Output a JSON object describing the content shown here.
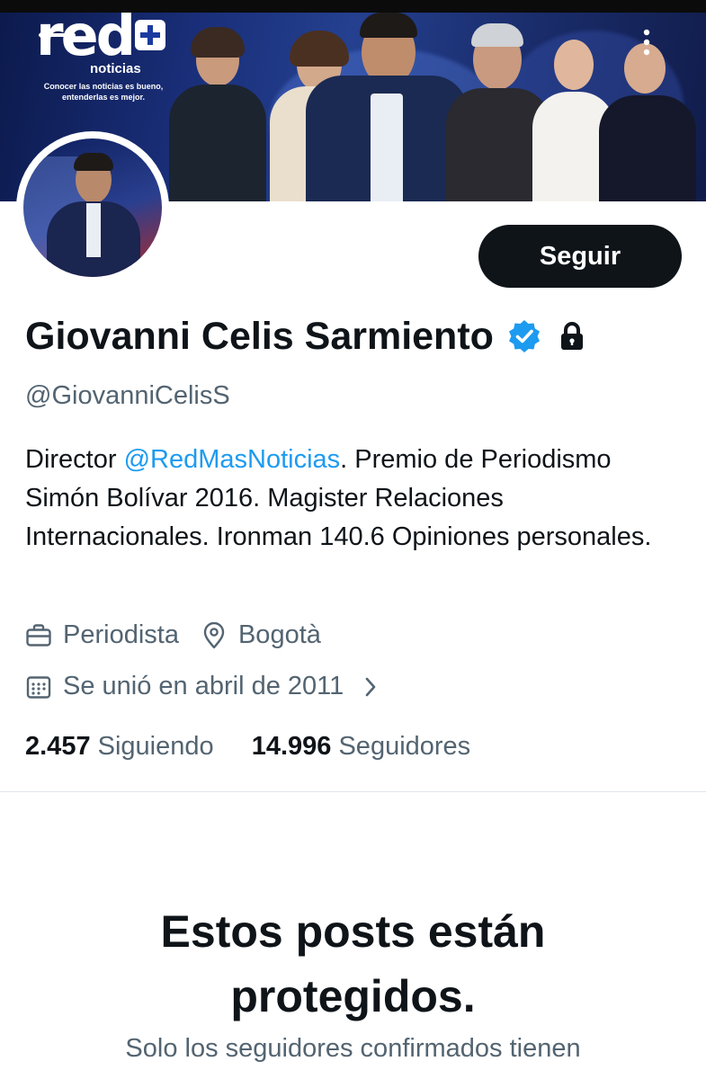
{
  "banner": {
    "logo_text": "red",
    "logo_subtitle": "noticias",
    "tagline": "Conocer las noticias es bueno, entenderlas es mejor."
  },
  "profile": {
    "follow_label": "Seguir",
    "name": "Giovanni Celis Sarmiento",
    "handle": "@GiovanniCelisS",
    "bio": {
      "prefix": "Director ",
      "mention": "@RedMasNoticias",
      "rest": ". Premio de Periodismo Simón Bolívar 2016. Magister Relaciones Internacionales. Ironman 140.6 Opiniones personales."
    },
    "profession": "Periodista",
    "location": "Bogotà",
    "joined": "Se unió en abril de 2011",
    "following_count": "2.457",
    "following_label": "Siguiendo",
    "followers_count": "14.996",
    "followers_label": "Seguidores"
  },
  "protected": {
    "title": "Estos posts están protegidos.",
    "subtitle": "Solo los seguidores confirmados tienen"
  },
  "colors": {
    "accent": "#1d9bf0",
    "text": "#0f1419",
    "muted": "#536471",
    "button": "#0f1419"
  },
  "icons": [
    "back-arrow-icon",
    "more-vertical-icon",
    "verified-badge-icon",
    "lock-icon",
    "briefcase-icon",
    "location-pin-icon",
    "calendar-icon",
    "chevron-right-icon"
  ]
}
